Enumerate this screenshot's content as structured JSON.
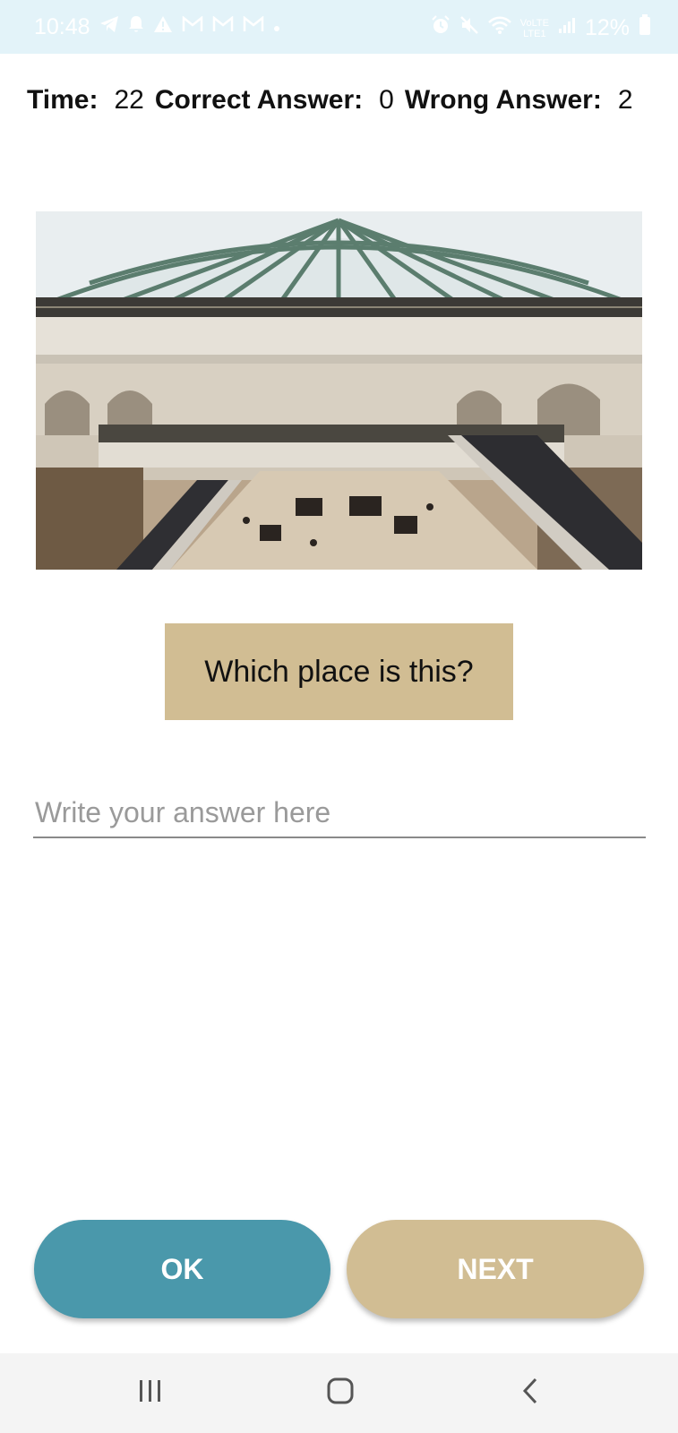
{
  "status_bar": {
    "time": "10:48",
    "battery": "12%",
    "network_label_top": "VoLTE",
    "network_label_bottom": "LTE1",
    "left_icons": [
      "telegram-icon",
      "bell-icon",
      "warning-icon",
      "gmail-icon",
      "gmail-icon",
      "gmail-icon",
      "dot-icon"
    ],
    "right_icons": [
      "alarm-icon",
      "mute-icon",
      "wifi-icon",
      "signal-icon",
      "battery-icon"
    ]
  },
  "score": {
    "time_label": "Time:",
    "time_value": "22",
    "correct_label": "Correct Answer:",
    "correct_value": "0",
    "wrong_label": "Wrong Answer:",
    "wrong_value": "2"
  },
  "question": {
    "text": "Which place is this?"
  },
  "answer": {
    "placeholder": "Write your answer here",
    "value": ""
  },
  "buttons": {
    "ok_label": "OK",
    "next_label": "NEXT"
  },
  "colors": {
    "ok_button": "#4a98ab",
    "next_button": "#d1bd93",
    "question_bg": "#d1bd93",
    "status_bar_bg": "#e3f3f9"
  },
  "nav": {
    "icons": [
      "recents-icon",
      "home-icon",
      "back-icon"
    ]
  }
}
